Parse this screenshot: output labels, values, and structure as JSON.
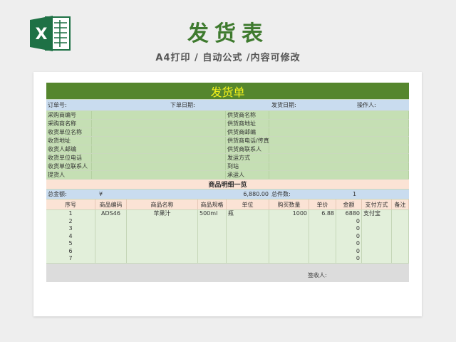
{
  "header": {
    "title": "发货表",
    "subtitle": "A4打印 / 自动公式 /内容可修改",
    "logo_letter": "X"
  },
  "sheet": {
    "banner": "发货单",
    "meta": {
      "order_no": "订单号:",
      "order_date": "下单日期:",
      "ship_date": "发货日期:",
      "operator": "操作人:"
    },
    "info_rows": [
      {
        "left": "采购商编号",
        "right": "供货商名称"
      },
      {
        "left": "采购商名称",
        "right": "供货商地址"
      },
      {
        "left": "收货单位名称",
        "right": "供货商邮编"
      },
      {
        "left": "收货地址",
        "right": "供货商电话/传真"
      },
      {
        "left": "收货人邮编",
        "right": "供货商联系人"
      },
      {
        "left": "收货单位电话",
        "right": "发运方式"
      },
      {
        "left": "收货单位联系人",
        "right": "到站"
      },
      {
        "left": "提货人",
        "right": "承运人"
      }
    ],
    "detail_title": "商品明细一览",
    "totals": {
      "amount_label": "总金额:",
      "currency": "¥",
      "amount": "6,880.00",
      "count_label": "总件数:",
      "count": "1"
    },
    "columns": [
      "序号",
      "商品编码",
      "商品名称",
      "商品规格",
      "单位",
      "购买数量",
      "单价",
      "金额",
      "支付方式",
      "备注"
    ],
    "rows": [
      {
        "no": "1",
        "code": "ADS46",
        "name": "苹果汁",
        "spec": "500ml",
        "unit": "瓶",
        "qty": "1000",
        "price": "6.88",
        "amount": "6880",
        "pay": "支付宝",
        "note": ""
      },
      {
        "no": "2",
        "code": "",
        "name": "",
        "spec": "",
        "unit": "",
        "qty": "",
        "price": "",
        "amount": "0",
        "pay": "",
        "note": ""
      },
      {
        "no": "3",
        "code": "",
        "name": "",
        "spec": "",
        "unit": "",
        "qty": "",
        "price": "",
        "amount": "0",
        "pay": "",
        "note": ""
      },
      {
        "no": "4",
        "code": "",
        "name": "",
        "spec": "",
        "unit": "",
        "qty": "",
        "price": "",
        "amount": "0",
        "pay": "",
        "note": ""
      },
      {
        "no": "5",
        "code": "",
        "name": "",
        "spec": "",
        "unit": "",
        "qty": "",
        "price": "",
        "amount": "0",
        "pay": "",
        "note": ""
      },
      {
        "no": "6",
        "code": "",
        "name": "",
        "spec": "",
        "unit": "",
        "qty": "",
        "price": "",
        "amount": "0",
        "pay": "",
        "note": ""
      },
      {
        "no": "7",
        "code": "",
        "name": "",
        "spec": "",
        "unit": "",
        "qty": "",
        "price": "",
        "amount": "0",
        "pay": "",
        "note": ""
      }
    ],
    "signature_label": "签收人:"
  }
}
